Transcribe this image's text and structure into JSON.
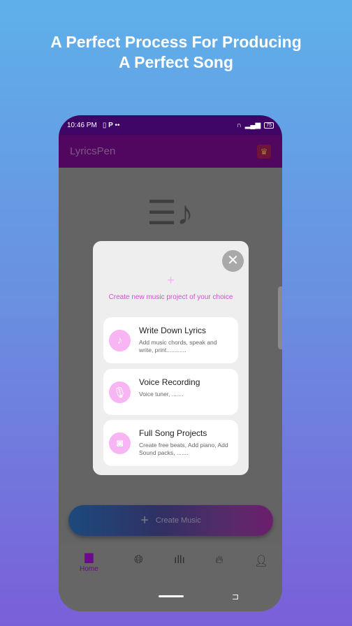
{
  "headline": {
    "line1": "A Perfect Process For Producing",
    "line2": "A Perfect Song"
  },
  "status": {
    "time": "10:46 PM",
    "battery": "75"
  },
  "appbar": {
    "title": "LyricsPen",
    "crown_icon": "crown-icon"
  },
  "dialog": {
    "subtitle": "Create new music project of your choice",
    "options": [
      {
        "title": "Write Down Lyrics",
        "desc": "Add music chords, speak and write, print............",
        "icon": "music-note-icon"
      },
      {
        "title": "Voice Recording",
        "desc": "Voice tuner, .......",
        "icon": "microphone-icon"
      },
      {
        "title": "Full Song Projects",
        "desc": "Create free beats, Add piano, Add Sound packs, .......",
        "icon": "speaker-icon"
      }
    ]
  },
  "fab": {
    "label": "Create Music"
  },
  "nav": {
    "home": "Home"
  },
  "colors": {
    "accent": "#d24fd4",
    "status_bar": "#3f0566",
    "nav_active": "#6b0a8a"
  }
}
